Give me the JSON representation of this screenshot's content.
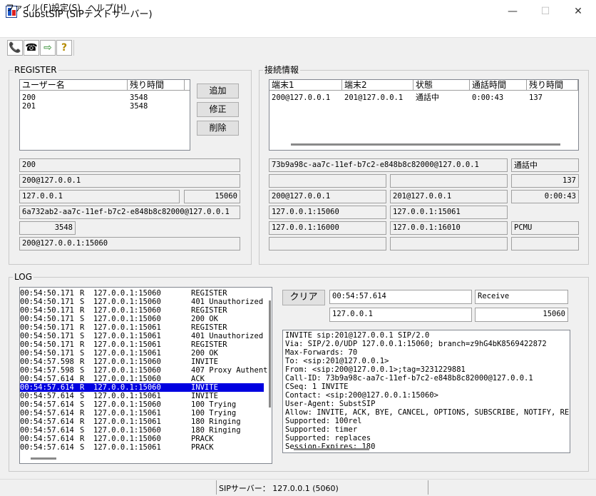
{
  "window": {
    "title": "SubstSIP (SIPテストサーバー)",
    "minimize_glyph": "—",
    "maximize_glyph": "☐",
    "close_glyph": "✕"
  },
  "menu": {
    "file": "ファイル(F)",
    "settings": "設定(S)",
    "help": "ヘルプ(H)"
  },
  "toolbar": {
    "call_icon": "phone-icon",
    "hangup_icon": "hangup-icon",
    "exit_icon": "exit-door-icon",
    "help_icon": "help-icon",
    "call_glyph": "📞",
    "hangup_glyph": "☎",
    "exit_glyph": "⇨",
    "help_glyph": "?"
  },
  "register": {
    "title": "REGISTER",
    "columns": [
      "ユーザー名",
      "残り時間"
    ],
    "rows": [
      {
        "user": "200",
        "remaining": "3548"
      },
      {
        "user": "201",
        "remaining": "3548"
      }
    ],
    "buttons": {
      "add": "追加",
      "edit": "修正",
      "delete": "削除"
    },
    "fields": {
      "user": "200",
      "aor": "200@127.0.0.1",
      "ip": "127.0.0.1",
      "port": "15060",
      "call_id": "6a732ab2-aa7c-11ef-b7c2-e848b8c82000@127.0.0.1",
      "expires": "3548",
      "contact": "200@127.0.0.1:15060"
    }
  },
  "connection": {
    "title": "接続情報",
    "columns": [
      "端末1",
      "端末2",
      "状態",
      "通話時間",
      "残り時間"
    ],
    "rows": [
      {
        "term1": "200@127.0.0.1",
        "term2": "201@127.0.0.1",
        "state": "通話中",
        "duration": "0:00:43",
        "remaining": "137"
      }
    ],
    "fields": {
      "call_id": "73b9a98c-aa7c-11ef-b7c2-e848b8c82000@127.0.0.1",
      "state": "通話中",
      "blank1": "",
      "blank2": "",
      "remaining": "137",
      "term1": "200@127.0.0.1",
      "term2": "201@127.0.0.1",
      "duration": "0:00:43",
      "sig1": "127.0.0.1:15060",
      "sig2": "127.0.0.1:15061",
      "blank3": "",
      "media1": "127.0.0.1:16000",
      "media2": "127.0.0.1:16010",
      "codec": "PCMU",
      "blank4": "",
      "blank5": "",
      "blank6": ""
    }
  },
  "log": {
    "title": "LOG",
    "entries": [
      {
        "time": "00:54:50.171",
        "dir": "R",
        "addr": "127.0.0.1:15060",
        "msg": "REGISTER"
      },
      {
        "time": "00:54:50.171",
        "dir": "S",
        "addr": "127.0.0.1:15060",
        "msg": "401 Unauthorized"
      },
      {
        "time": "00:54:50.171",
        "dir": "R",
        "addr": "127.0.0.1:15060",
        "msg": "REGISTER"
      },
      {
        "time": "00:54:50.171",
        "dir": "S",
        "addr": "127.0.0.1:15060",
        "msg": "200 OK"
      },
      {
        "time": "00:54:50.171",
        "dir": "R",
        "addr": "127.0.0.1:15061",
        "msg": "REGISTER"
      },
      {
        "time": "00:54:50.171",
        "dir": "S",
        "addr": "127.0.0.1:15061",
        "msg": "401 Unauthorized"
      },
      {
        "time": "00:54:50.171",
        "dir": "R",
        "addr": "127.0.0.1:15061",
        "msg": "REGISTER"
      },
      {
        "time": "00:54:50.171",
        "dir": "S",
        "addr": "127.0.0.1:15061",
        "msg": "200 OK"
      },
      {
        "time": "00:54:57.598",
        "dir": "R",
        "addr": "127.0.0.1:15060",
        "msg": "INVITE"
      },
      {
        "time": "00:54:57.598",
        "dir": "S",
        "addr": "127.0.0.1:15060",
        "msg": "407 Proxy Authent"
      },
      {
        "time": "00:54:57.614",
        "dir": "R",
        "addr": "127.0.0.1:15060",
        "msg": "ACK"
      },
      {
        "time": "00:54:57.614",
        "dir": "R",
        "addr": "127.0.0.1:15060",
        "msg": "INVITE",
        "selected": true
      },
      {
        "time": "00:54:57.614",
        "dir": "S",
        "addr": "127.0.0.1:15061",
        "msg": "INVITE"
      },
      {
        "time": "00:54:57.614",
        "dir": "S",
        "addr": "127.0.0.1:15060",
        "msg": "100 Trying"
      },
      {
        "time": "00:54:57.614",
        "dir": "R",
        "addr": "127.0.0.1:15061",
        "msg": "100 Trying"
      },
      {
        "time": "00:54:57.614",
        "dir": "R",
        "addr": "127.0.0.1:15061",
        "msg": "180 Ringing"
      },
      {
        "time": "00:54:57.614",
        "dir": "S",
        "addr": "127.0.0.1:15060",
        "msg": "180 Ringing"
      },
      {
        "time": "00:54:57.614",
        "dir": "R",
        "addr": "127.0.0.1:15060",
        "msg": "PRACK"
      },
      {
        "time": "00:54:57.614",
        "dir": "S",
        "addr": "127.0.0.1:15061",
        "msg": "PRACK"
      }
    ],
    "clear_button": "クリア",
    "detail": {
      "time": "00:54:57.614",
      "direction": "Receive",
      "ip": "127.0.0.1",
      "port": "15060"
    },
    "message_lines": [
      "INVITE sip:201@127.0.0.1 SIP/2.0",
      "Via: SIP/2.0/UDP 127.0.0.1:15060; branch=z9hG4bK8569422872",
      "Max-Forwards: 70",
      "To: <sip:201@127.0.0.1>",
      "From: <sip:200@127.0.0.1>;tag=3231229881",
      "Call-ID: 73b9a98c-aa7c-11ef-b7c2-e848b8c82000@127.0.0.1",
      "CSeq: 1 INVITE",
      "Contact: <sip:200@127.0.0.1:15060>",
      "User-Agent: SubstSIP",
      "Allow: INVITE, ACK, BYE, CANCEL, OPTIONS, SUBSCRIBE, NOTIFY, REFER",
      "Supported: 100rel",
      "Supported: timer",
      "Supported: replaces",
      "Session-Expires: 180"
    ]
  },
  "status": {
    "server": "SIPサーバー：  127.0.0.1 (5060)"
  }
}
